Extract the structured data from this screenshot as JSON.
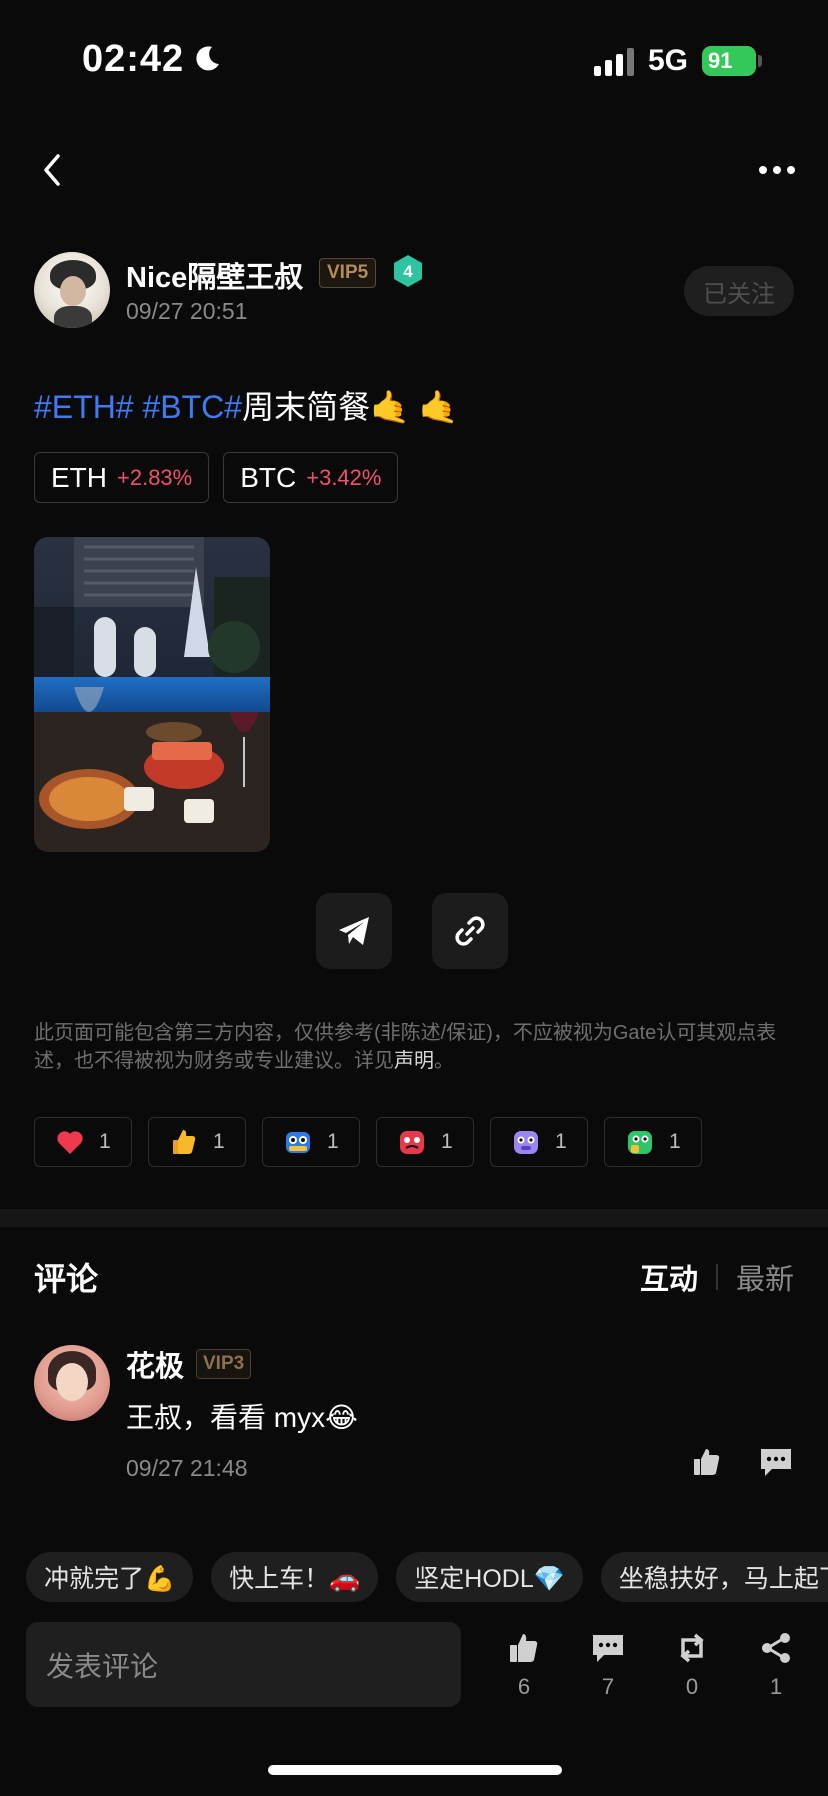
{
  "status_bar": {
    "time": "02:42",
    "network": "5G",
    "battery": "91"
  },
  "post": {
    "author": {
      "name": "Nice隔壁王叔",
      "vip": "VIP5",
      "level": "4",
      "time": "09/27 20:51",
      "follow_label": "已关注"
    },
    "text": {
      "tag1": "#ETH#",
      "tag2": "#BTC#",
      "body": "周末简餐",
      "emoji": "🤙 🤙"
    },
    "tickers": [
      {
        "symbol": "ETH",
        "change": "+2.83%"
      },
      {
        "symbol": "BTC",
        "change": "+3.42%"
      }
    ],
    "disclaimer": {
      "text": "此页面可能包含第三方内容，仅供参考(非陈述/保证)，不应被视为Gate认可其观点表述，也不得被视为财务或专业建议。详见",
      "link": "声明",
      "end": "。"
    },
    "reactions": [
      {
        "icon": "heart-icon",
        "count": "1"
      },
      {
        "icon": "thumbs-up-icon",
        "count": "1"
      },
      {
        "icon": "hodl-robot-icon",
        "count": "1"
      },
      {
        "icon": "angry-face-icon",
        "count": "1"
      },
      {
        "icon": "purple-monster-icon",
        "count": "1"
      },
      {
        "icon": "green-monster-icon",
        "count": "1"
      }
    ]
  },
  "comments": {
    "title": "评论",
    "sort_active": "互动",
    "sort_inactive": "最新",
    "items": [
      {
        "name": "花极",
        "vip": "VIP3",
        "text": "王叔，看看 myx😂",
        "time": "09/27 21:48"
      }
    ]
  },
  "quick_replies": [
    "冲就完了💪",
    "快上车！🚗",
    "坚定HODL💎",
    "坐稳扶好，马上起飞"
  ],
  "bottom_bar": {
    "placeholder": "发表评论",
    "likes": "6",
    "comments": "7",
    "reposts": "0",
    "shares": "1"
  },
  "colors": {
    "accent_link": "#3d7bf7",
    "positive_change": "#f0506e",
    "battery": "#34c759",
    "vip_gold": "#b48c5a"
  }
}
